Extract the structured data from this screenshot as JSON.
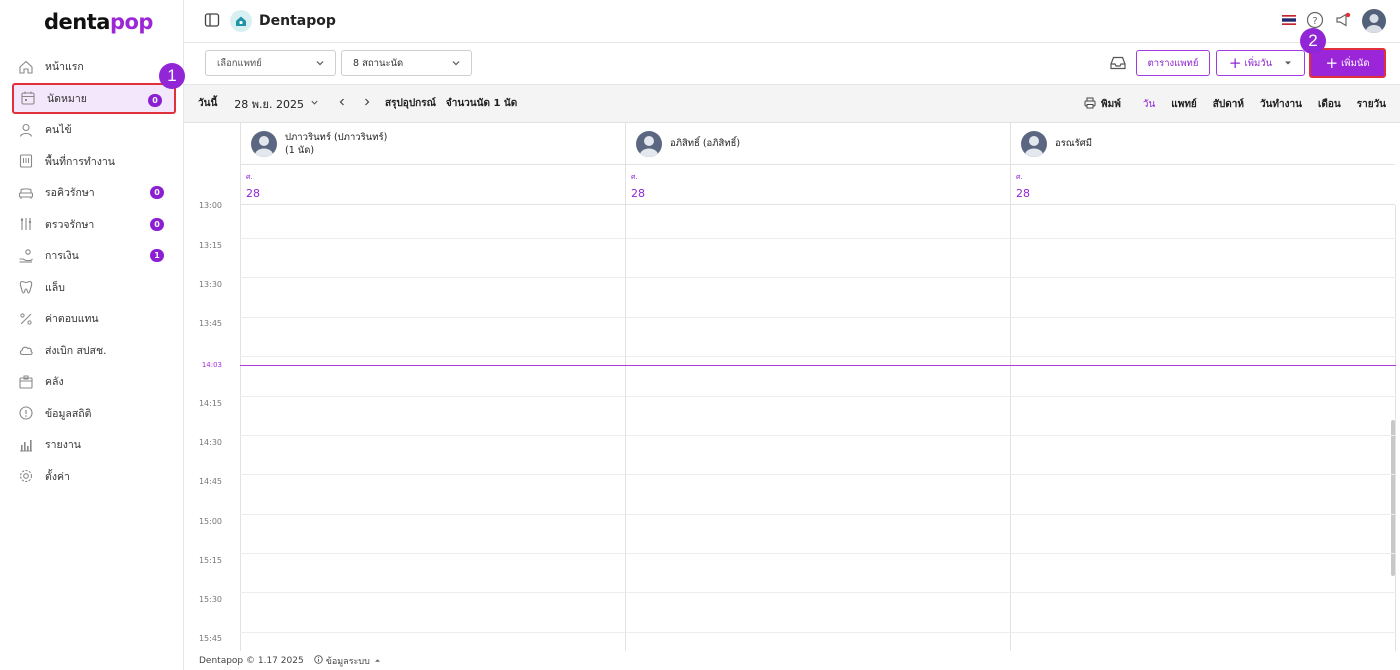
{
  "app": {
    "logo_main": "denta",
    "logo_accent": "pop",
    "title": "Dentapop"
  },
  "sidebar": {
    "items": [
      {
        "label": "หน้าแรก",
        "icon": "home-icon"
      },
      {
        "label": "นัดหมาย",
        "icon": "calendar-icon",
        "badge": "0",
        "active": true
      },
      {
        "label": "คนไข้",
        "icon": "user-icon"
      },
      {
        "label": "พื้นที่การทำงาน",
        "icon": "workspace-icon"
      },
      {
        "label": "รอคิวรักษา",
        "icon": "sofa-icon",
        "badge": "0"
      },
      {
        "label": "ตรวจรักษา",
        "icon": "tools-icon",
        "badge": "0"
      },
      {
        "label": "การเงิน",
        "icon": "hand-coin-icon",
        "badge": "1"
      },
      {
        "label": "แล็บ",
        "icon": "tooth-icon"
      },
      {
        "label": "ค่าตอบแทน",
        "icon": "percent-icon"
      },
      {
        "label": "ส่งเบิก สปสช.",
        "icon": "cloud-icon"
      },
      {
        "label": "คลัง",
        "icon": "box-icon"
      },
      {
        "label": "ข้อมูลสถิติ",
        "icon": "stats-icon"
      },
      {
        "label": "รายงาน",
        "icon": "bar-chart-icon"
      },
      {
        "label": "ตั้งค่า",
        "icon": "gear-icon"
      }
    ]
  },
  "markers": {
    "first": "1",
    "second": "2"
  },
  "toolbar": {
    "doctor_select_placeholder": "เลือกแพทย์",
    "status_select_value": "8 สถานะนัด",
    "doctor_schedule_label": "ตารางแพทย์",
    "add_day_label": "เพิ่มวัน",
    "add_appointment_label": "เพิ่มนัด"
  },
  "datebar": {
    "today_label": "วันนี้",
    "date_label": "28 พ.ย. 2025",
    "equipment_summary_label": "สรุปอุปกรณ์",
    "appointment_count_label": "จำนวนนัด 1 นัด",
    "print_label": "พิมพ์",
    "views": [
      "วัน",
      "แพทย์",
      "สัปดาห์",
      "วันทำงาน",
      "เดือน",
      "รายวัน"
    ],
    "active_view": "วัน"
  },
  "calendar": {
    "doctors": [
      {
        "name": "ปภาวรินทร์ (ปภาวรินทร์)",
        "sub": "(1 นัด)"
      },
      {
        "name": "อภิสิทธิ์ (อภิสิทธิ์)",
        "sub": ""
      },
      {
        "name": "อรณรัศมี",
        "sub": ""
      }
    ],
    "day_abbr": "ศ.",
    "day_num": "28",
    "times": [
      "13:00",
      "13:15",
      "13:30",
      "13:45",
      "14:03",
      "14:15",
      "14:30",
      "14:45",
      "15:00",
      "15:15",
      "15:30",
      "15:45"
    ],
    "current_time": "14:03"
  },
  "footer": {
    "version": "Dentapop © 1.17 2025",
    "system_info": "ข้อมูลระบบ"
  },
  "colors": {
    "accent": "#9b26d9",
    "highlight": "#e0303a",
    "active_bg": "#f3e7fb"
  }
}
